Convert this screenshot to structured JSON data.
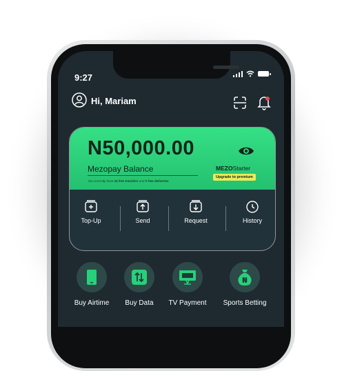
{
  "status_bar": {
    "time": "9:27"
  },
  "header": {
    "greeting": "Hi, Mariam"
  },
  "balance_card": {
    "amount": "N50,000.00",
    "label": "Mezopay Balance",
    "note_prefix": "You currently have",
    "note_transfers": "24 free transfers",
    "note_and": "and",
    "note_deliveries": "0 free deliveries",
    "tier_brand": "MEZO",
    "tier_name": "Starter",
    "upgrade_label": "Upgrade to premium",
    "actions": [
      {
        "label": "Top-Up",
        "icon": "plus-square-icon"
      },
      {
        "label": "Send",
        "icon": "arrow-up-square-icon"
      },
      {
        "label": "Request",
        "icon": "arrow-down-square-icon"
      },
      {
        "label": "History",
        "icon": "clock-icon"
      }
    ]
  },
  "services": [
    {
      "label": "Buy Airtime",
      "icon": "phone-icon"
    },
    {
      "label": "Buy Data",
      "icon": "data-arrows-icon"
    },
    {
      "label": "TV Payment",
      "icon": "tv-icon"
    },
    {
      "label": "Sports Betting",
      "icon": "money-bag-icon"
    }
  ],
  "colors": {
    "screen_bg": "#1e2a30",
    "card_green": "#2ed47a",
    "upgrade_yellow": "#e8ec5a",
    "service_circle": "#2d4a48",
    "icon_green": "#27d07a"
  }
}
